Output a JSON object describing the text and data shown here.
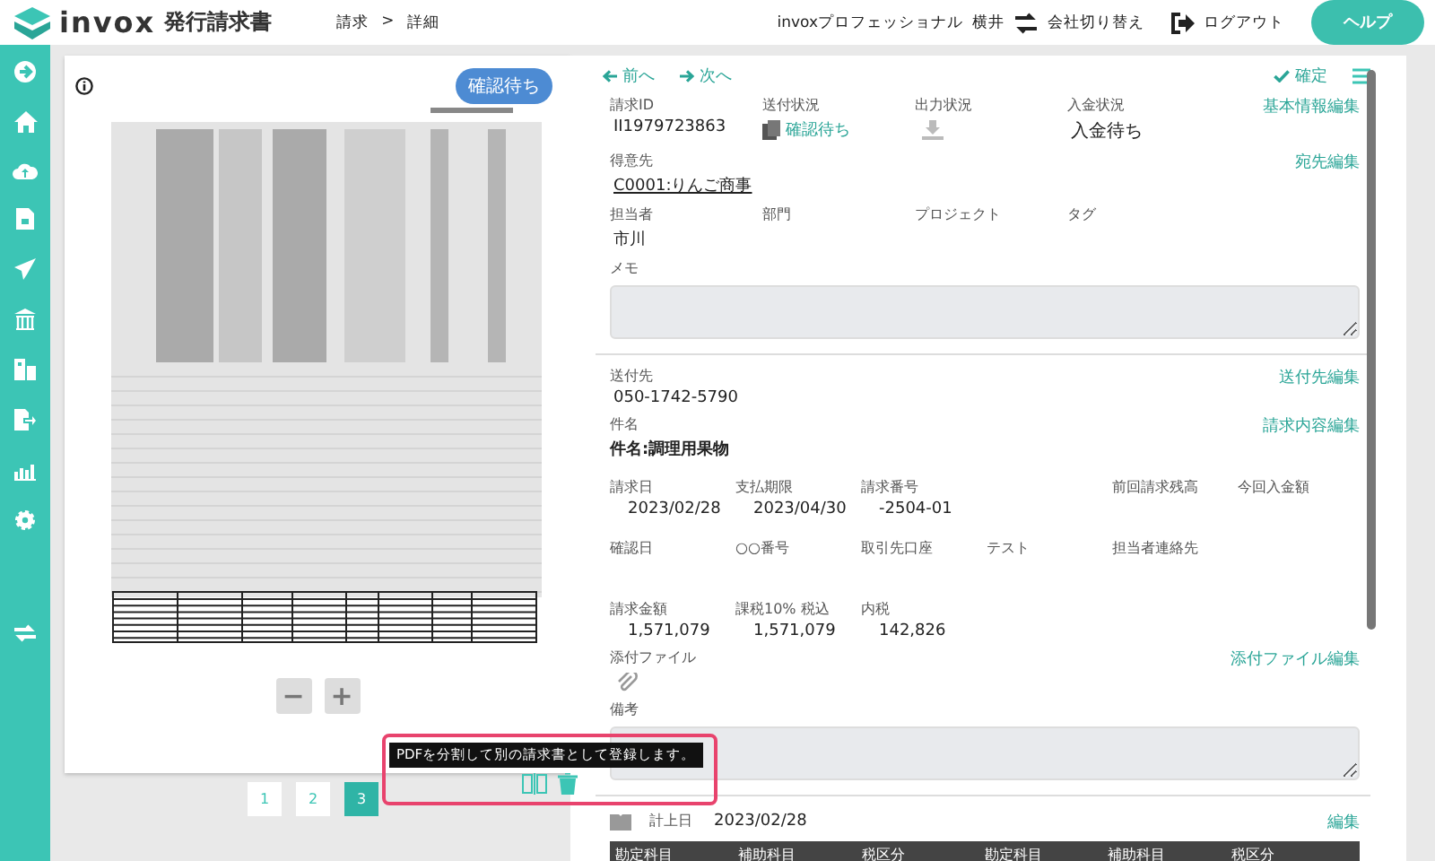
{
  "header": {
    "logo_text": "invox",
    "app_name": "発行請求書",
    "breadcrumb": [
      "請求",
      "詳細"
    ],
    "breadcrumb_separator": ">",
    "user_plan": "invoxプロフェッショナル",
    "user_name": "横井",
    "switch_company": "会社切り替え",
    "logout": "ログアウト",
    "help": "ヘルプ"
  },
  "preview": {
    "status_badge": "確認待ち",
    "zoom_out": "−",
    "zoom_in": "+",
    "pages": [
      {
        "label": "1",
        "selected": false
      },
      {
        "label": "2",
        "selected": false
      },
      {
        "label": "3",
        "selected": true
      }
    ],
    "tooltip": "PDFを分割して別の請求書として登録します。"
  },
  "detail": {
    "prev": "前へ",
    "next": "次へ",
    "confirm": "確定",
    "basic_edit": "基本情報編集",
    "status_fields": [
      {
        "label": "請求ID",
        "value": "II1979723863",
        "kind": "text"
      },
      {
        "label": "送付状況",
        "value": "確認待ち",
        "kind": "status"
      },
      {
        "label": "出力状況",
        "kind": "download"
      },
      {
        "label": "入金状況",
        "value": "入金待ち",
        "kind": "bold"
      }
    ],
    "customer": {
      "label": "得意先",
      "value": "C0001:りんご商事",
      "edit": "宛先編集"
    },
    "owner_fields": [
      {
        "label": "担当者",
        "value": "市川"
      },
      {
        "label": "部門"
      },
      {
        "label": "プロジェクト"
      },
      {
        "label": "タグ"
      }
    ],
    "memo_label": "メモ",
    "recipient": {
      "label": "送付先",
      "value": "050-1742-5790",
      "edit": "送付先編集"
    },
    "subject": {
      "label": "件名",
      "value": "件名:調理用果物",
      "edit": "請求内容編集"
    },
    "grid_rows": [
      [
        {
          "label": "請求日",
          "value": "2023/02/28"
        },
        {
          "label": "支払期限",
          "value": "2023/04/30"
        },
        {
          "label": "請求番号",
          "value": "-2504-01"
        },
        null,
        {
          "label": "前回請求残高"
        },
        {
          "label": "今回入金額"
        }
      ],
      [
        {
          "label": "確認日"
        },
        {
          "label": "○○番号"
        },
        {
          "label": "取引先口座"
        },
        {
          "label": "テスト"
        },
        {
          "label": "担当者連絡先"
        }
      ],
      [
        {
          "label": "請求金額",
          "value": "1,571,079"
        },
        {
          "label": "課税10% 税込",
          "value": "1,571,079"
        },
        {
          "label": "内税",
          "value": "142,826"
        }
      ]
    ],
    "attachments": {
      "label": "添付ファイル",
      "edit": "添付ファイル編集"
    },
    "remarks_label": "備考",
    "journal": {
      "label": "計上日",
      "date": "2023/02/28",
      "edit": "編集",
      "columns": [
        "勘定科目",
        "補助科目",
        "税区分",
        "勘定科目",
        "補助科目",
        "税区分"
      ]
    }
  }
}
